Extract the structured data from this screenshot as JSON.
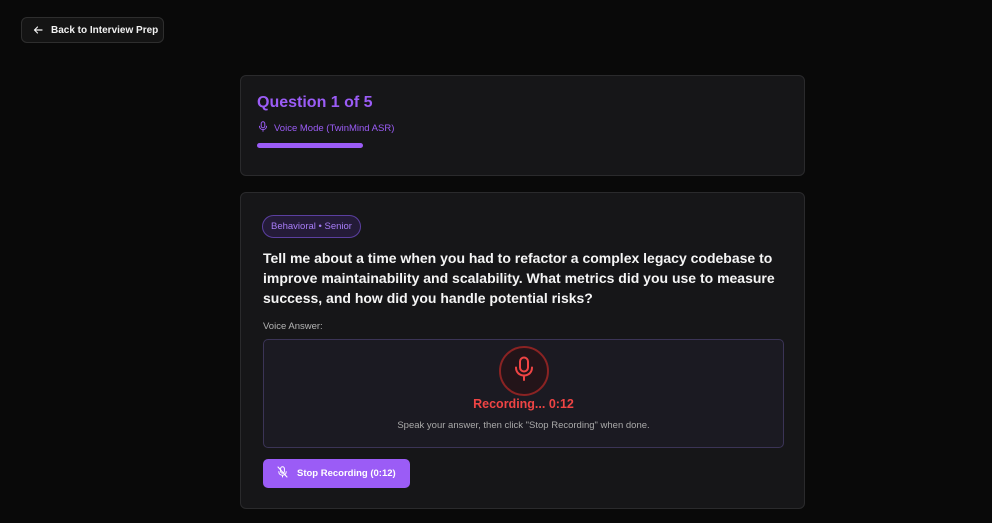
{
  "nav": {
    "back_label": "Back to Interview Prep"
  },
  "progress_card": {
    "title": "Question 1 of 5",
    "mode": "Voice Mode (TwinMind ASR)",
    "progress_fraction": 0.2
  },
  "question_card": {
    "tag": "Behavioral • Senior",
    "question": "Tell me about a time when you had to refactor a complex legacy codebase to improve maintainability and scalability. What metrics did you use to measure success, and how did you handle potential risks?",
    "voice_label": "Voice Answer:",
    "recording_status": "Recording... 0:12",
    "recording_hint": "Speak your answer, then click \"Stop Recording\" when done.",
    "stop_button_label": "Stop Recording (0:12)"
  },
  "icons": {
    "back": "arrow-left-icon",
    "mode": "microphone-icon",
    "recording": "microphone-icon",
    "stop": "microphone-off-icon"
  },
  "colors": {
    "accent": "#9b5cf6",
    "recording": "#ef4444",
    "background": "#090909",
    "card": "#161618"
  }
}
